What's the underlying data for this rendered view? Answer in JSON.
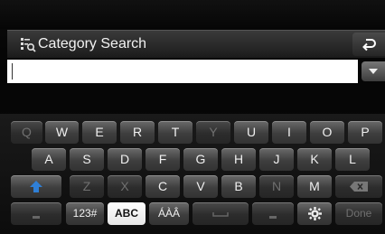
{
  "header": {
    "title": "Category Search",
    "icon": "category-search-icon",
    "back_icon": "return-arrow-icon"
  },
  "search": {
    "value": "",
    "dropdown_icon": "chevron-down-icon"
  },
  "keyboard": {
    "row1": [
      "Q",
      "W",
      "E",
      "R",
      "T",
      "Y",
      "U",
      "I",
      "O",
      "P"
    ],
    "row2": [
      "A",
      "S",
      "D",
      "F",
      "G",
      "H",
      "J",
      "K",
      "L"
    ],
    "row3": [
      "Z",
      "X",
      "C",
      "V",
      "B",
      "N",
      "M"
    ],
    "shift_icon": "shift-arrow-icon",
    "backspace_icon": "backspace-icon",
    "mode_123": "123#",
    "mode_abc": "ABC",
    "mode_accents": "ÁÀÂ",
    "space_icon": "space-icon",
    "settings_icon": "gear-icon",
    "done_label": "Done",
    "colors": {
      "shift_accent": "#2f7fd6",
      "selected_bg": "#ffffff"
    }
  }
}
